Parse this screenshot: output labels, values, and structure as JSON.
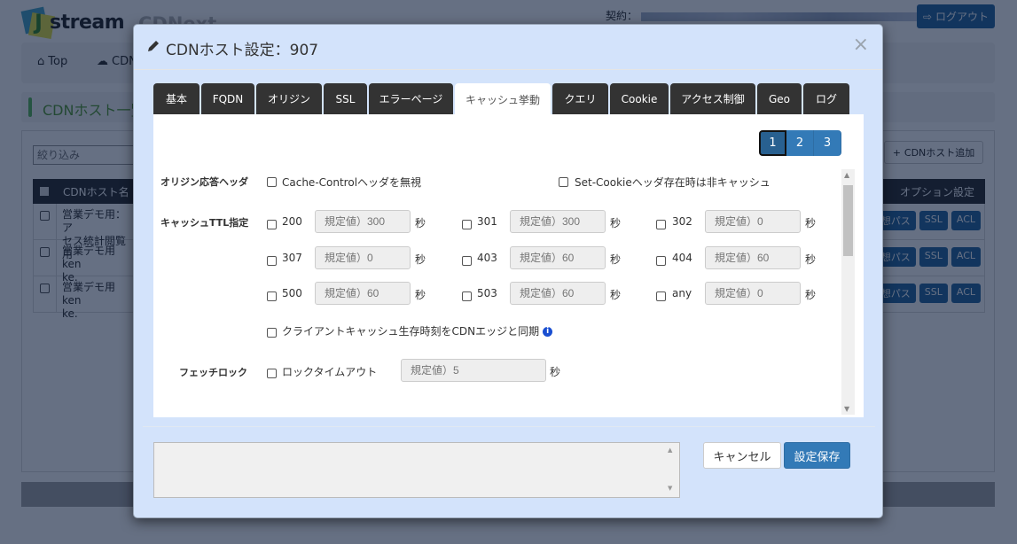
{
  "app": {
    "logo_mark": "J",
    "logo_brand": "stream",
    "logo_product": "CDNext",
    "contract_label": "契約：",
    "logout_label": "ログアウト"
  },
  "breadcrumb": [
    {
      "icon": "home-icon",
      "label": "Top"
    },
    {
      "icon": "cloud-icon",
      "label": "CDN"
    }
  ],
  "page_title": "CDNホスト一覧",
  "list": {
    "filter_placeholder": "絞り込み",
    "add_button": "CDNホスト追加",
    "columns": [
      "CDNホスト名",
      "オプション設定"
    ],
    "rows": [
      {
        "name_line1": "営業デモ用：ア",
        "name_line2": "セス統計閲覧用",
        "options": [
          "仮想パス",
          "SSL",
          "ACL"
        ]
      },
      {
        "name_line1": "営業デモ用 ken",
        "name_line2": "ke.",
        "options": [
          "仮想パス",
          "SSL",
          "ACL"
        ]
      },
      {
        "name_line1": "営業デモ用 ken",
        "name_line2": "ke.",
        "options": [
          "仮想パス",
          "SSL",
          "ACL"
        ]
      }
    ]
  },
  "modal": {
    "title": "CDNホスト設定：907",
    "close_label": "×",
    "tabs": [
      {
        "label": "基本",
        "active": false
      },
      {
        "label": "FQDN",
        "active": false
      },
      {
        "label": "オリジン",
        "active": false
      },
      {
        "label": "SSL",
        "active": false
      },
      {
        "label": "エラーページ",
        "active": false
      },
      {
        "label": "キャッシュ挙動",
        "active": true
      },
      {
        "label": "クエリ",
        "active": false
      },
      {
        "label": "Cookie",
        "active": false
      },
      {
        "label": "アクセス制御",
        "active": false
      },
      {
        "label": "Geo",
        "active": false
      },
      {
        "label": "ログ",
        "active": false
      }
    ],
    "pages": [
      "1",
      "2",
      "3"
    ],
    "current_page": "1",
    "origin_header": {
      "label": "オリジン応答ヘッダ",
      "options": [
        "Cache-Controlヘッダを無視",
        "Set-Cookieヘッダ存在時は非キャッシュ"
      ]
    },
    "cache_ttl": {
      "label": "キャッシュTTL指定",
      "unit": "秒",
      "entries": [
        {
          "code": "200",
          "placeholder": "規定値）300"
        },
        {
          "code": "301",
          "placeholder": "規定値）300"
        },
        {
          "code": "302",
          "placeholder": "規定値）0"
        },
        {
          "code": "307",
          "placeholder": "規定値）0"
        },
        {
          "code": "403",
          "placeholder": "規定値）60"
        },
        {
          "code": "404",
          "placeholder": "規定値）60"
        },
        {
          "code": "500",
          "placeholder": "規定値）60"
        },
        {
          "code": "503",
          "placeholder": "規定値）60"
        },
        {
          "code": "any",
          "placeholder": "規定値）0"
        }
      ],
      "sync_option": "クライアントキャッシュ生存時刻をCDNエッジと同期"
    },
    "fetch_lock": {
      "label": "フェッチロック",
      "option": "ロックタイムアウト",
      "placeholder": "規定値）5",
      "unit": "秒"
    },
    "memo_value": "",
    "cancel_label": "キャンセル",
    "save_label": "設定保存"
  }
}
